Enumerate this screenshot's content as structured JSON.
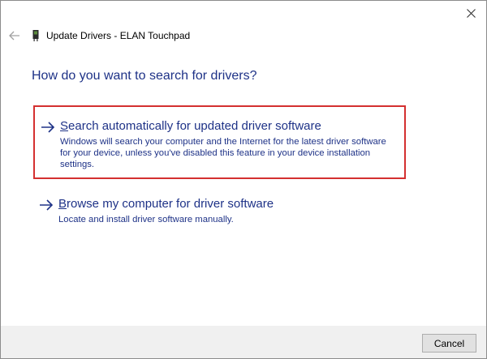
{
  "window": {
    "title": "Update Drivers - ELAN Touchpad",
    "heading": "How do you want to search for drivers?"
  },
  "options": [
    {
      "accel": "S",
      "title_rest": "earch automatically for updated driver software",
      "description": "Windows will search your computer and the Internet for the latest driver software for your device, unless you've disabled this feature in your device installation settings."
    },
    {
      "accel": "B",
      "title_rest": "rowse my computer for driver software",
      "description": "Locate and install driver software manually."
    }
  ],
  "footer": {
    "cancel_label": "Cancel"
  },
  "colors": {
    "link_blue": "#1e3287",
    "highlight_red": "#d43030"
  },
  "icons": {
    "close": "close-icon",
    "back": "back-arrow-icon",
    "device": "device-manager-icon",
    "option_arrow": "arrow-right-icon"
  }
}
